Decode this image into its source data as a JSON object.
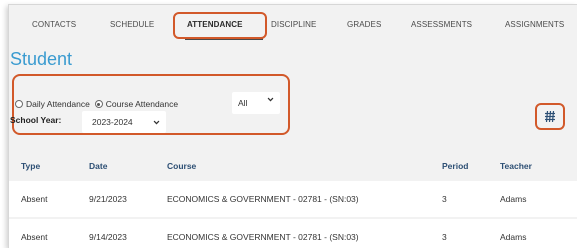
{
  "tabs": {
    "items": [
      {
        "label": "CONTACTS"
      },
      {
        "label": "SCHEDULE"
      },
      {
        "label": "ATTENDANCE"
      },
      {
        "label": "DISCIPLINE"
      },
      {
        "label": "GRADES"
      },
      {
        "label": "ASSESSMENTS"
      },
      {
        "label": "ASSIGNMENTS"
      }
    ],
    "active": "ATTENDANCE"
  },
  "page": {
    "title": "Student"
  },
  "filters": {
    "daily_label": "Daily Attendance",
    "course_label": "Course Attendance",
    "selected_mode": "Course Attendance",
    "type_value": "All",
    "school_year_label": "School Year:",
    "school_year_value": "2023-2024"
  },
  "table": {
    "headers": {
      "type": "Type",
      "date": "Date",
      "course": "Course",
      "period": "Period",
      "teacher": "Teacher"
    },
    "rows": [
      {
        "type": "Absent",
        "date": "9/21/2023",
        "course": "ECONOMICS & GOVERNMENT - 02781 - (SN:03)",
        "period": "3",
        "teacher": "Adams"
      },
      {
        "type": "Absent",
        "date": "9/14/2023",
        "course": "ECONOMICS & GOVERNMENT - 02781 - (SN:03)",
        "period": "3",
        "teacher": "Adams"
      }
    ]
  },
  "colors": {
    "accent": "#3a9bd0",
    "highlight": "#d2592a",
    "header_text": "#2d4f74"
  },
  "icons": {
    "toggle": "grid-toggle-icon",
    "select": "chevron-down-icon"
  }
}
